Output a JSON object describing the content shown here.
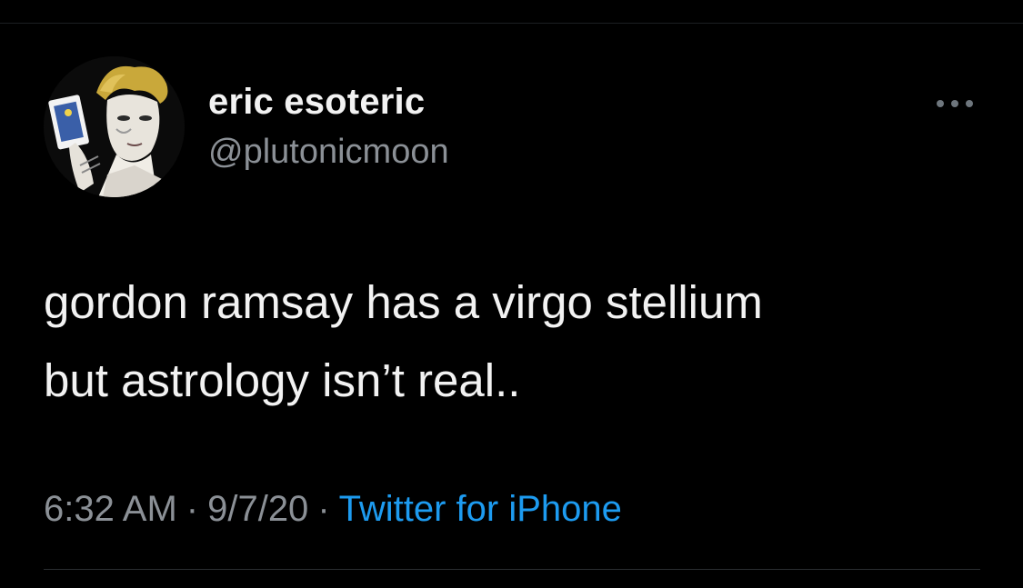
{
  "tweet": {
    "author": {
      "display_name": "eric esoteric",
      "handle": "@plutonicmoon",
      "avatar_icon": "profile-avatar"
    },
    "more_icon": "more-options-icon",
    "text_lines": [
      "gordon ramsay has a virgo stellium",
      "but astrology isn’t real.."
    ],
    "meta": {
      "time": "6:32 AM",
      "separator": "·",
      "date": "9/7/20",
      "source": "Twitter for iPhone"
    }
  },
  "colors": {
    "background": "#000000",
    "primary_text": "#f2f2f2",
    "secondary_text": "#8b9096",
    "link": "#1d9bf0",
    "divider": "#2a2d31"
  }
}
